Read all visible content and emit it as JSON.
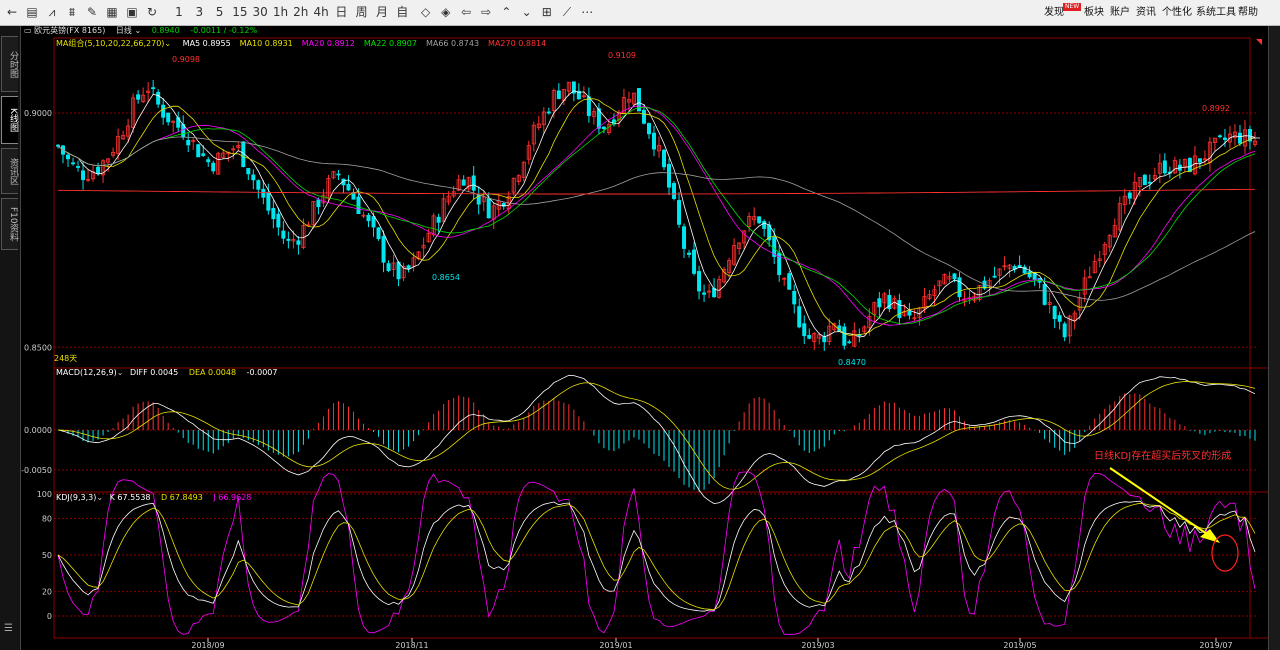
{
  "toolbar": {
    "icons": [
      {
        "name": "back-icon",
        "glyph": "←"
      },
      {
        "name": "table-icon",
        "glyph": "▤"
      },
      {
        "name": "line-chart-icon",
        "glyph": "⩘"
      },
      {
        "name": "candlestick-icon",
        "glyph": "⩩"
      },
      {
        "name": "drawing-icon",
        "glyph": "✎"
      },
      {
        "name": "calendar-icon",
        "glyph": "▦"
      },
      {
        "name": "save-icon",
        "glyph": "▣"
      },
      {
        "name": "refresh-icon",
        "glyph": "↻"
      }
    ],
    "periods": [
      "1",
      "3",
      "5",
      "15",
      "30",
      "1h",
      "2h",
      "4h",
      "日",
      "周",
      "月",
      "自"
    ],
    "tool_icons": [
      {
        "name": "diamond-icon",
        "glyph": "◇"
      },
      {
        "name": "expand-icon",
        "glyph": "◈"
      },
      {
        "name": "arrow-left-icon",
        "glyph": "⇦"
      },
      {
        "name": "arrow-right-icon",
        "glyph": "⇨"
      },
      {
        "name": "chevron-double-up-icon",
        "glyph": "⌃"
      },
      {
        "name": "chevron-double-down-icon",
        "glyph": "⌄"
      },
      {
        "name": "grid-icon",
        "glyph": "⊞"
      },
      {
        "name": "draw-line-icon",
        "glyph": "⟋"
      },
      {
        "name": "more-icon",
        "glyph": "⋯"
      }
    ],
    "menu": [
      "发现",
      "板块",
      "账户",
      "资讯",
      "个性化",
      "系统工具",
      "帮助"
    ],
    "new_badge": "NEW"
  },
  "left_tabs": [
    {
      "label": "分时图",
      "active": false
    },
    {
      "label": "K线图",
      "active": true
    },
    {
      "label": "资讯区",
      "active": false
    },
    {
      "label": "F10资料",
      "active": false
    }
  ],
  "header": {
    "symbol": "欧元英镑(FX 8165)",
    "period": "日线",
    "price": "0.8940",
    "change": "-0.0011 / -0.12%"
  },
  "ma": {
    "label": "MA组合(5,10,20,22,66,270)",
    "items": [
      {
        "label": "MA5 0.8955",
        "color": "#ffffff"
      },
      {
        "label": "MA10 0.8931",
        "color": "#e8e000"
      },
      {
        "label": "MA20 0.8912",
        "color": "#ff00ff"
      },
      {
        "label": "MA22 0.8907",
        "color": "#00e000"
      },
      {
        "label": "MA66 0.8743",
        "color": "#a0a0a0"
      },
      {
        "label": "MA270 0.8814",
        "color": "#ff3030"
      }
    ]
  },
  "macd": {
    "label": "MACD(12,26,9)",
    "diff": "DIFF 0.0045",
    "dea": "DEA 0.0048",
    "macd": "-0.0007"
  },
  "kdj": {
    "label": "KDJ(9,3,3)",
    "k": "K 67.5538",
    "d": "D 67.8493",
    "j": "J 66.9628"
  },
  "days_label": "248天",
  "annotation": "日线KDJ存在超买后死叉的形成",
  "colors": {
    "up": "#ff3030",
    "down": "#00e5ee",
    "grid": "#8b0000",
    "axis": "#cccccc"
  },
  "chart_data": {
    "type": "candlestick",
    "price_axis": {
      "ticks": [
        "0.9000",
        "0.8500"
      ],
      "ylim": [
        0.846,
        0.916
      ]
    },
    "macd_axis": {
      "ticks": [
        "0.0000",
        "-0.0050"
      ]
    },
    "kdj_axis": {
      "ticks": [
        "100",
        "80",
        "50",
        "20",
        "0"
      ]
    },
    "x_ticks": [
      "2018/09",
      "2018/11",
      "2019/01",
      "2019/03",
      "2019/05",
      "2019/07"
    ],
    "annotations": [
      "0.9098",
      "0.8654",
      "0.9109",
      "0.8470",
      "0.8992"
    ],
    "close_path": [
      0.893,
      0.889,
      0.887,
      0.888,
      0.891,
      0.896,
      0.902,
      0.906,
      0.901,
      0.898,
      0.896,
      0.892,
      0.889,
      0.891,
      0.893,
      0.888,
      0.882,
      0.877,
      0.872,
      0.874,
      0.879,
      0.884,
      0.887,
      0.883,
      0.878,
      0.873,
      0.867,
      0.865,
      0.868,
      0.874,
      0.879,
      0.884,
      0.887,
      0.882,
      0.879,
      0.882,
      0.887,
      0.894,
      0.899,
      0.904,
      0.906,
      0.903,
      0.899,
      0.897,
      0.901,
      0.905,
      0.899,
      0.893,
      0.884,
      0.873,
      0.864,
      0.86,
      0.865,
      0.872,
      0.876,
      0.878,
      0.871,
      0.863,
      0.857,
      0.852,
      0.852,
      0.856,
      0.85,
      0.853,
      0.858,
      0.861,
      0.858,
      0.855,
      0.859,
      0.863,
      0.864,
      0.861,
      0.862,
      0.864,
      0.866,
      0.868,
      0.866,
      0.863,
      0.858,
      0.852,
      0.859,
      0.866,
      0.872,
      0.878,
      0.881,
      0.885,
      0.887,
      0.889,
      0.888,
      0.889,
      0.891,
      0.893,
      0.895,
      0.895,
      0.894
    ]
  }
}
